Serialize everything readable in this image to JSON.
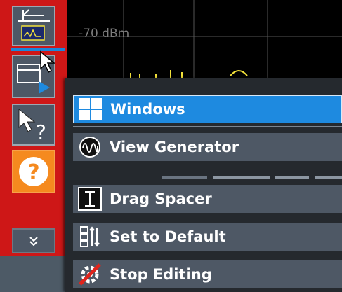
{
  "display": {
    "reference_level_label": "-70 dBm"
  },
  "toolbar": {
    "buttons": [
      {
        "name": "spectrum-view-button"
      },
      {
        "name": "window-layout-button"
      },
      {
        "name": "context-help-button"
      },
      {
        "name": "help-button",
        "glyph": "?"
      },
      {
        "name": "more-button",
        "glyph": "»"
      }
    ]
  },
  "context_menu": {
    "items": [
      {
        "label": "Windows",
        "state": "highlighted"
      },
      {
        "label": "View Generator"
      },
      {
        "label": "Drag Spacer"
      },
      {
        "label": "Set to Default"
      },
      {
        "label": "Stop Editing"
      }
    ]
  },
  "colors": {
    "toolbar_red": "#ce1717",
    "menu_item": "#4e5865",
    "highlight": "#1e8ae0",
    "trace_yellow": "#f3e23a",
    "help_orange": "#f58a1f"
  }
}
